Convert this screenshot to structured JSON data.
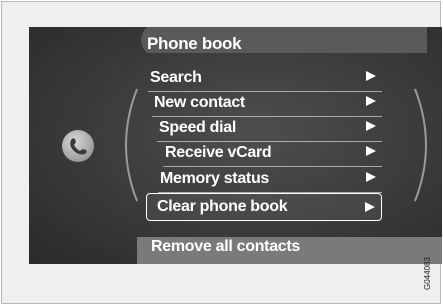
{
  "header": {
    "title": "Phone book"
  },
  "menu": {
    "items": [
      {
        "label": "Search"
      },
      {
        "label": "New contact"
      },
      {
        "label": "Speed dial"
      },
      {
        "label": "Receive vCard"
      },
      {
        "label": "Memory status"
      },
      {
        "label": "Clear phone book",
        "selected": true
      }
    ]
  },
  "footer": {
    "text": "Remove all contacts"
  },
  "image_code": "G044083",
  "icons": {
    "left": "phone-icon",
    "item_arrow": "right-arrow-icon"
  },
  "colors": {
    "screen": "#3a3a3a",
    "text": "#ffffff",
    "footer_bar": "#7a7a7a"
  }
}
